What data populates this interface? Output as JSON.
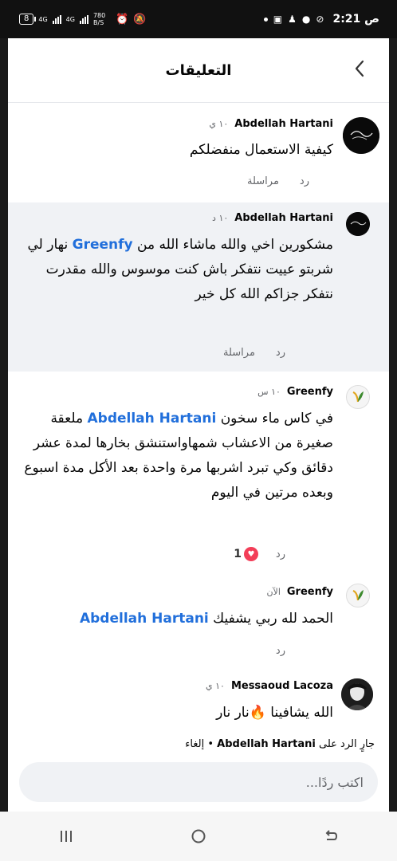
{
  "status_bar": {
    "battery": "8",
    "net1": "4G",
    "net2": "4G",
    "speed": "780 B/S",
    "time": "2:21 ص"
  },
  "header": {
    "title": "التعليقات"
  },
  "comments": [
    {
      "name": "Abdellah Hartani",
      "time": "١٠ ي",
      "text": "كيفية الاستعمال منفضلكم",
      "reply": "رد",
      "message": "مراسلة"
    },
    {
      "name": "Abdellah Hartani",
      "time": "١٠ د",
      "text_before": "مشكورين اخي والله ماشاء الله من ",
      "mention": "Greenfy",
      "text_after": " نهار لي شربتو عييت نتفكر باش كنت موسوس والله مقدرت نتفكر جزاكم الله كل خير",
      "reply": "رد",
      "message": "مراسلة"
    },
    {
      "name": "Greenfy",
      "time": "١٠ س",
      "mention": "Abdellah Hartani",
      "text_before": "في كاس ماء سخون ",
      "text_after": " ملعقة صغيرة من الاعشاب شمهاواستنشق بخارها  لمدة عشر دقائق وكي تبرد اشربها مرة واحدة بعد الأكل مدة اسبوع وبعده مرتين في اليوم",
      "reply": "رد",
      "reactions_count": "1"
    },
    {
      "name": "Greenfy",
      "time": "الآن",
      "text_before": "الحمد لله ربي يشفيك ",
      "mention": "Abdellah Hartani",
      "reply": "رد"
    },
    {
      "name": "Messaoud Lacoza",
      "time": "١٠ ي",
      "text": "الله يشافينا 🔥نار نار"
    }
  ],
  "reply_bar": {
    "prefix": "جارٍ الرد على",
    "name": "Abdellah Hartani",
    "sep": " • ",
    "cancel": "إلغاء"
  },
  "input": {
    "placeholder": "اكتب ردًا..."
  },
  "colors": {
    "mention": "#216fdb",
    "highlight_bg": "#f0f2f5",
    "heart": "#f33e58"
  }
}
